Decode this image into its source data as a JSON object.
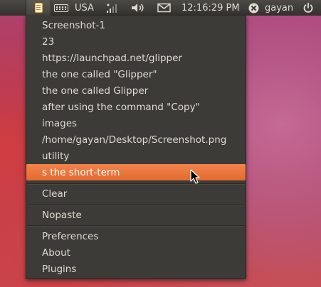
{
  "panel": {
    "keyboard_layout": "USA",
    "clock": "12:16:29 PM",
    "user": "gayan",
    "icons": [
      "glipper-clipboard-icon",
      "keyboard-icon",
      "network-signal-icon",
      "volume-icon",
      "mail-icon",
      "user-status-icon",
      "power-icon"
    ]
  },
  "menu": {
    "history": [
      "Screenshot-1",
      "23",
      "https://launchpad.net/glipper",
      "the one called \"Glipper\"",
      "the one called Glipper",
      "after using the command \"Copy\"",
      "images",
      "/home/gayan/Desktop/Screenshot.png",
      "utility",
      "s the short-term"
    ],
    "selected_index": 9,
    "clear": "Clear",
    "nopaste": "Nopaste",
    "preferences": "Preferences",
    "about": "About",
    "plugins": "Plugins"
  },
  "colors": {
    "panel_bg": "#3c3b37",
    "menu_bg": "#3c3b37",
    "highlight": "#e9763b",
    "text": "#dfdbd2"
  }
}
